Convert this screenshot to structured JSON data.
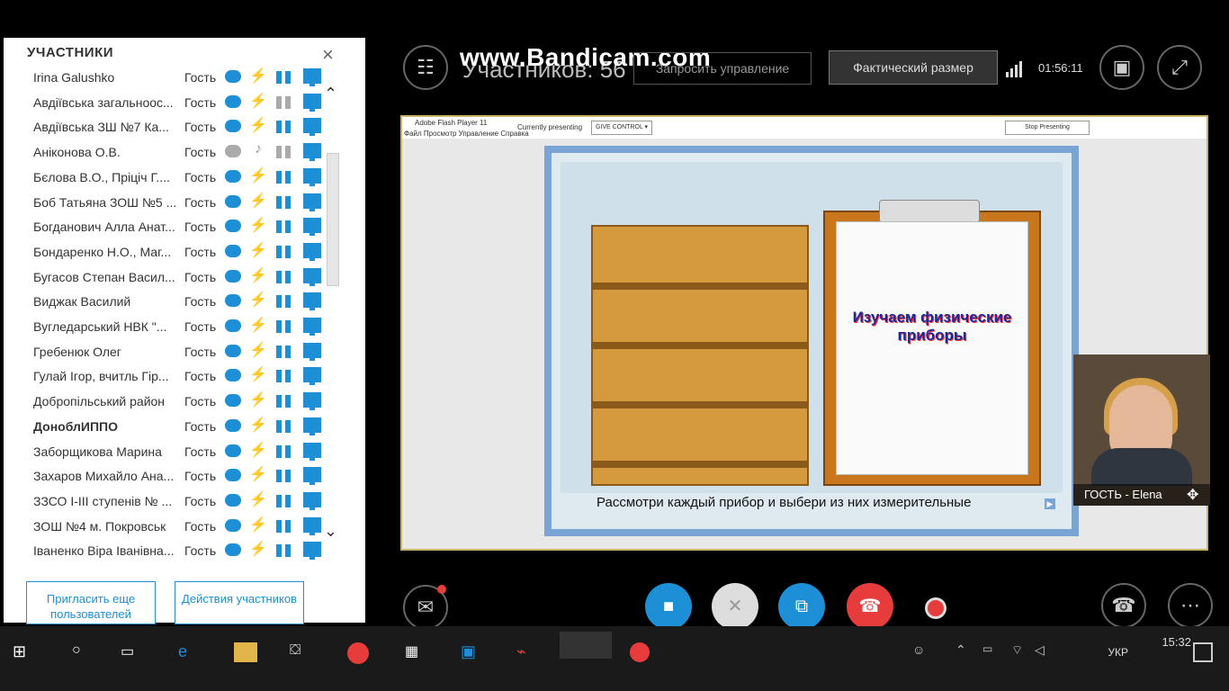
{
  "panel": {
    "title": "УЧАСТНИКИ",
    "close_label": "×",
    "role_label": "Гость",
    "participants": [
      {
        "name": "Irina Galushko",
        "bold": false
      },
      {
        "name": "Авдіївська загальноос...",
        "bold": false
      },
      {
        "name": "Авдіївська ЗШ №7 Ка...",
        "bold": false
      },
      {
        "name": "Аніконова О.В.",
        "bold": false
      },
      {
        "name": "Бєлова В.О., Пріціч Г....",
        "bold": false
      },
      {
        "name": "Боб Татьяна ЗОШ №5 ...",
        "bold": false
      },
      {
        "name": "Богданович Алла Анат...",
        "bold": false
      },
      {
        "name": "Бондаренко Н.О., Маг...",
        "bold": false
      },
      {
        "name": "Бугасов Степан Васил...",
        "bold": false
      },
      {
        "name": "Виджак Василий",
        "bold": false
      },
      {
        "name": "Вугледарський НВК \"...",
        "bold": false
      },
      {
        "name": "Гребенюк Олег",
        "bold": false
      },
      {
        "name": "Гулай Ігор, вчитль Гір...",
        "bold": false
      },
      {
        "name": "Добропільський район",
        "bold": false
      },
      {
        "name": "ДоноблИППО",
        "bold": true
      },
      {
        "name": "Заборщикова Марина",
        "bold": false
      },
      {
        "name": "Захаров Михайло Ана...",
        "bold": false
      },
      {
        "name": "ЗЗСО І-ІІІ ступенів № ...",
        "bold": false
      },
      {
        "name": "ЗОШ №4 м. Покровськ",
        "bold": false
      },
      {
        "name": "Іваненко Віра Іванівна...",
        "bold": false
      }
    ],
    "invite_label": "Пригласить еще пользователей",
    "actions_label": "Действия участников"
  },
  "meeting": {
    "participants_count": "Участников: 56",
    "watermark": "www.Bandicam.com",
    "request_control": "Запросить управление",
    "actual_size": "Фактический размер",
    "duration": "01:56:11",
    "guest_label": "ГОСТЬ - Elena"
  },
  "flash": {
    "title": "Adobe Flash Player 11",
    "menu": "Файл   Просмотр   Управление   Справка",
    "presenting": "Currently presenting",
    "give_control": "GIVE CONTROL ▾",
    "stop_presenting": "Stop Presenting"
  },
  "slide": {
    "heading": "Изучаем физические приборы",
    "caption": "Рассмотри каждый прибор и выбери из них измерительные"
  },
  "taskbar": {
    "lang": "УКР",
    "time": "15:32"
  },
  "colors": {
    "accent": "#1d8fd6",
    "hangup": "#e63c3c",
    "panel_bg": "#ffffff"
  }
}
